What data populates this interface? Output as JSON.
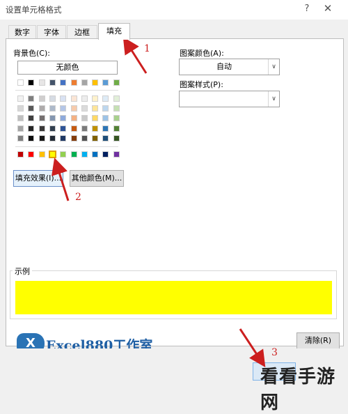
{
  "window": {
    "title": "设置单元格格式",
    "help": "?",
    "close": "✕"
  },
  "tabs": [
    {
      "label": "数字",
      "active": false
    },
    {
      "label": "字体",
      "active": false
    },
    {
      "label": "边框",
      "active": false
    },
    {
      "label": "填充",
      "active": true
    }
  ],
  "background_color": {
    "label": "背景色(C):",
    "no_color_label": "无颜色",
    "theme_top_row": [
      "#ffffff",
      "#000000",
      "#e7e6e6",
      "#44546a",
      "#4472c4",
      "#ed7d31",
      "#a5a5a5",
      "#ffc000",
      "#5b9bd5",
      "#70ad47"
    ],
    "theme_shades": [
      [
        "#f2f2f2",
        "#7f7f7f",
        "#d0cece",
        "#d6dce4",
        "#d9e2f3",
        "#fbe5d5",
        "#ededed",
        "#fff2cc",
        "#deebf6",
        "#e2efd9"
      ],
      [
        "#d8d8d8",
        "#595959",
        "#aeabab",
        "#adb9ca",
        "#b4c6e7",
        "#f7cbac",
        "#dbdbdb",
        "#fee599",
        "#bdd7ee",
        "#c5e0b3"
      ],
      [
        "#bfbfbf",
        "#3f3f3f",
        "#757070",
        "#8496b0",
        "#8eaadb",
        "#f4b183",
        "#c9c9c9",
        "#ffd965",
        "#9dc3e6",
        "#a8d08d"
      ],
      [
        "#a5a5a5",
        "#262626",
        "#3a3838",
        "#323f4f",
        "#2f5496",
        "#c55a11",
        "#7b7b7b",
        "#bf9000",
        "#2e75b5",
        "#538135"
      ],
      [
        "#7f7f7f",
        "#0c0c0c",
        "#171616",
        "#222a35",
        "#1f3864",
        "#833c0b",
        "#525252",
        "#7f6000",
        "#1e4e79",
        "#375623"
      ]
    ],
    "standard_colors": [
      "#c00000",
      "#ff0000",
      "#ffc000",
      "#ffff00",
      "#92d050",
      "#00b050",
      "#00b0f0",
      "#0070c0",
      "#002060",
      "#7030a0"
    ],
    "selected_standard_index": 3,
    "fill_effects_label": "填充效果(I)...",
    "more_colors_label": "其他颜色(M)..."
  },
  "pattern": {
    "color_label": "图案颜色(A):",
    "color_value": "自动",
    "style_label": "图案样式(P):",
    "style_value": ""
  },
  "sample": {
    "label": "示例",
    "fill_color": "#ffff00"
  },
  "clear_label": "清除(R)",
  "annotations": [
    "1",
    "2",
    "3"
  ],
  "logo": {
    "mark": "X",
    "text": "Excel880工作室"
  },
  "watermark": "看看手游网",
  "accent_colors": {
    "annotation_red": "#cc1f1f",
    "selection_blue": "#6a8fc9"
  }
}
